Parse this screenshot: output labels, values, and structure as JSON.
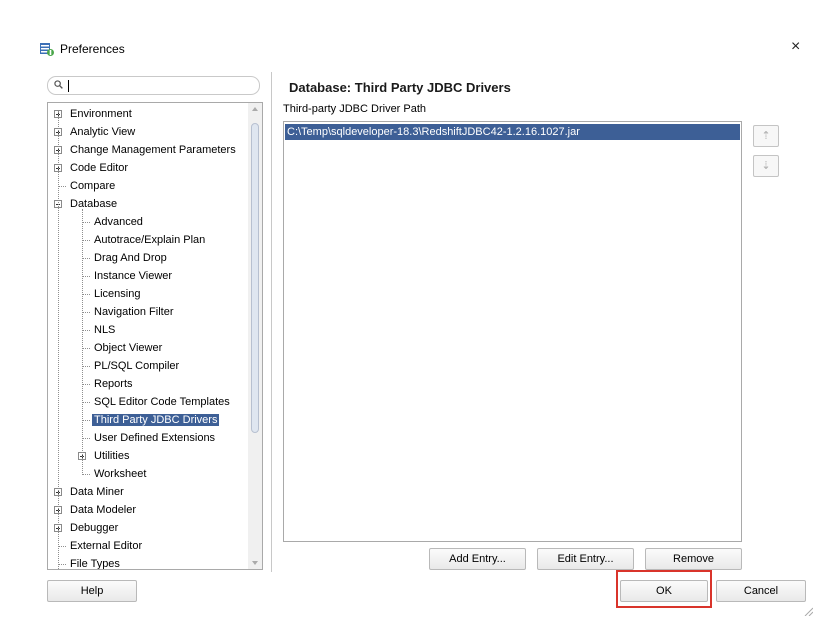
{
  "window": {
    "title": "Preferences",
    "close_glyph": "×"
  },
  "search": {
    "placeholder": "",
    "value": ""
  },
  "tree": {
    "items": [
      {
        "label": "Environment",
        "level": 0,
        "expander": "plus"
      },
      {
        "label": "Analytic View",
        "level": 0,
        "expander": "plus"
      },
      {
        "label": "Change Management Parameters",
        "level": 0,
        "expander": "plus"
      },
      {
        "label": "Code Editor",
        "level": 0,
        "expander": "plus"
      },
      {
        "label": "Compare",
        "level": 0,
        "expander": "none"
      },
      {
        "label": "Database",
        "level": 0,
        "expander": "minus"
      },
      {
        "label": "Advanced",
        "level": 1,
        "expander": "none"
      },
      {
        "label": "Autotrace/Explain Plan",
        "level": 1,
        "expander": "none"
      },
      {
        "label": "Drag And Drop",
        "level": 1,
        "expander": "none"
      },
      {
        "label": "Instance Viewer",
        "level": 1,
        "expander": "none"
      },
      {
        "label": "Licensing",
        "level": 1,
        "expander": "none"
      },
      {
        "label": "Navigation Filter",
        "level": 1,
        "expander": "none"
      },
      {
        "label": "NLS",
        "level": 1,
        "expander": "none"
      },
      {
        "label": "Object Viewer",
        "level": 1,
        "expander": "none"
      },
      {
        "label": "PL/SQL Compiler",
        "level": 1,
        "expander": "none"
      },
      {
        "label": "Reports",
        "level": 1,
        "expander": "none"
      },
      {
        "label": "SQL Editor Code Templates",
        "level": 1,
        "expander": "none"
      },
      {
        "label": "Third Party JDBC Drivers",
        "level": 1,
        "expander": "none",
        "selected": true
      },
      {
        "label": "User Defined Extensions",
        "level": 1,
        "expander": "none"
      },
      {
        "label": "Utilities",
        "level": 1,
        "expander": "plus"
      },
      {
        "label": "Worksheet",
        "level": 1,
        "expander": "none"
      },
      {
        "label": "Data Miner",
        "level": 0,
        "expander": "plus"
      },
      {
        "label": "Data Modeler",
        "level": 0,
        "expander": "plus"
      },
      {
        "label": "Debugger",
        "level": 0,
        "expander": "plus"
      },
      {
        "label": "External Editor",
        "level": 0,
        "expander": "none"
      },
      {
        "label": "File Types",
        "level": 0,
        "expander": "none"
      }
    ]
  },
  "panel": {
    "title": "Database: Third Party JDBC Drivers",
    "path_label": "Third-party JDBC Driver Path",
    "entries": [
      "C:\\Temp\\sqldeveloper-18.3\\RedshiftJDBC42-1.2.16.1027.jar"
    ],
    "move_up_glyph": "⇡",
    "move_down_glyph": "⇣",
    "add_label": "Add Entry...",
    "edit_label": "Edit Entry...",
    "remove_label": "Remove"
  },
  "footer": {
    "help_label": "Help",
    "ok_label": "OK",
    "cancel_label": "Cancel"
  },
  "colors": {
    "selection": "#3d5f96",
    "highlight": "#d9342b"
  }
}
